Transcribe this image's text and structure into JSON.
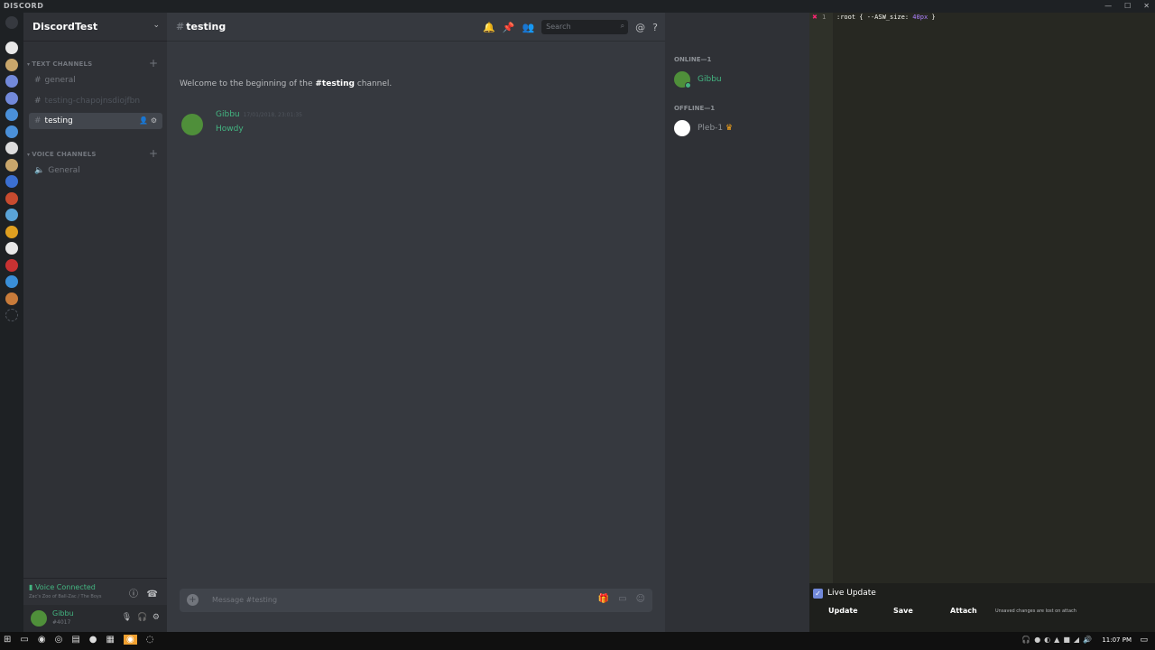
{
  "titlebar": {
    "brand": "DISCORD"
  },
  "guild_colors": [
    "#e8e8e8",
    "#c9a66b",
    "#7289da",
    "#7289da",
    "#4a90d9",
    "#4a90d9",
    "#dcdcdc",
    "#c9a66b",
    "#3b6fd1",
    "#c84b2f",
    "#5aa4d8",
    "#e0a020",
    "#e8e8e8",
    "#c83232",
    "#3a8fd8",
    "#c87b3a"
  ],
  "server": {
    "name": "DiscordTest",
    "chevron": "⌄"
  },
  "categories": {
    "text": "TEXT CHANNELS",
    "voice": "VOICE CHANNELS"
  },
  "text_channels": [
    {
      "name": "general",
      "state": "normal"
    },
    {
      "name": "testing-chapojnsdiojfbn",
      "state": "muted"
    },
    {
      "name": "testing",
      "state": "active"
    }
  ],
  "voice_channels": [
    {
      "name": "General",
      "icon": "speaker-icon"
    }
  ],
  "voice": {
    "status": "Voice Connected",
    "location": "Zac's Zoo of Ball-Zac / The Boys"
  },
  "user": {
    "name": "Gibbu",
    "tag": "#4017"
  },
  "chat": {
    "channel": "testing",
    "search_placeholder": "Search",
    "welcome_prefix": "Welcome to the beginning of the",
    "welcome_channel": "#testing",
    "welcome_suffix": "channel.",
    "message": {
      "author": "Gibbu",
      "timestamp": "17/01/2018, 23:01:35",
      "text": "Howdy"
    },
    "composer_placeholder": "Message #testing"
  },
  "members": {
    "online_header": "ONLINE—1",
    "offline_header": "OFFLINE—1",
    "online": [
      {
        "name": "Gibbu",
        "color": "#43b581"
      }
    ],
    "offline": [
      {
        "name": "Pleb-1",
        "color": "#8e9297",
        "badge": "♛"
      }
    ]
  },
  "editor": {
    "line_number": "1",
    "code_prefix": ":root { --ASW_size: ",
    "code_value": "40px",
    "code_suffix": " }",
    "live_update_label": "Live Update",
    "buttons": {
      "update": "Update",
      "save": "Save",
      "attach": "Attach"
    },
    "note": "Unsaved changes are lost on attach"
  },
  "taskbar": {
    "time": "11:07 PM"
  },
  "colors": {
    "accent": "#7289da",
    "online": "#43b581",
    "background": "#36393f"
  }
}
